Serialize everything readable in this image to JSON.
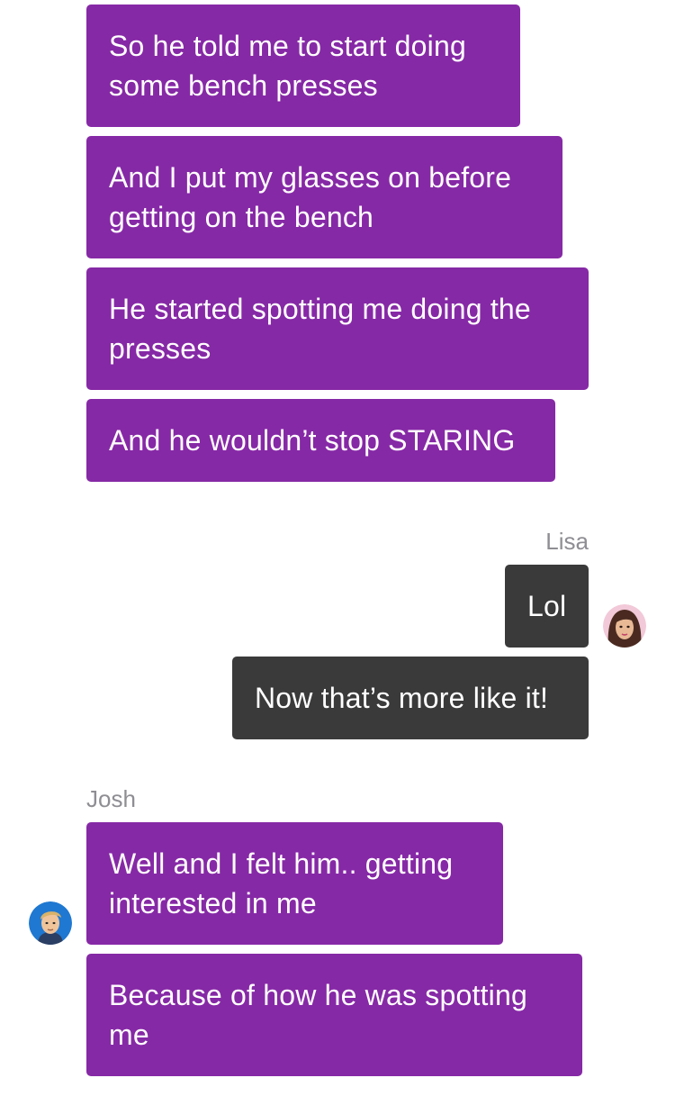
{
  "colors": {
    "josh_bubble": "#8629a6",
    "lisa_bubble": "#3a3a3a",
    "sender_name": "#8e8e93",
    "background": "#ffffff"
  },
  "group1": {
    "messages": [
      {
        "line1": "So he told me to start doing",
        "line2": "some bench presses"
      },
      {
        "line1": "And I put my glasses on before",
        "line2": "getting on the bench"
      },
      {
        "line1": "He started spotting me doing the",
        "line2": "presses"
      },
      {
        "line1": "And he wouldn’t stop STARING",
        "line2": ""
      }
    ]
  },
  "lisa": {
    "name": "Lisa",
    "avatar_icon": "lisa-avatar-icon",
    "messages": [
      "Lol",
      "Now that’s more like it!"
    ]
  },
  "josh": {
    "name": "Josh",
    "avatar_icon": "josh-avatar-icon",
    "messages": [
      {
        "line1": "Well and I felt him.. getting",
        "line2": "interested in me"
      },
      {
        "line1": "Because of how he was spotting",
        "line2": "me"
      }
    ]
  }
}
